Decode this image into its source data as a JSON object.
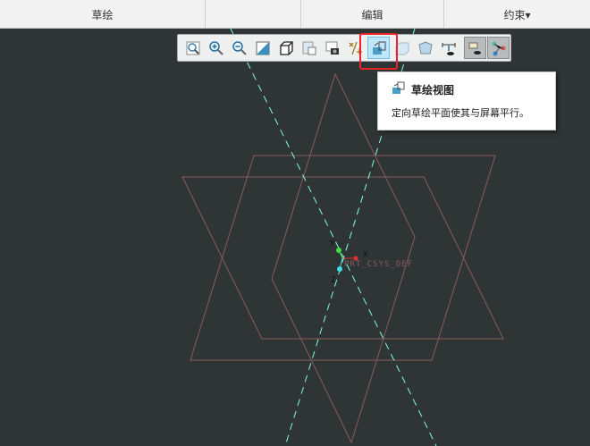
{
  "header": {
    "tabs": [
      {
        "label": "草绘"
      },
      {
        "label": "编辑"
      },
      {
        "label": "约束▾"
      }
    ]
  },
  "toolbar": {
    "buttons": [
      {
        "name": "refit-icon"
      },
      {
        "name": "zoom-in-icon"
      },
      {
        "name": "zoom-out-icon"
      },
      {
        "name": "repaint-icon"
      },
      {
        "name": "display-style-icon"
      },
      {
        "name": "saved-orientations-icon"
      },
      {
        "name": "view-manager-icon"
      },
      {
        "name": "datum-display-icon"
      },
      {
        "name": "sketch-view-icon",
        "active": true
      },
      {
        "name": "view-box-icon"
      },
      {
        "name": "perspective-icon"
      },
      {
        "name": "sketcher-display-icon"
      },
      {
        "name": "constraint-display-icon",
        "pressed": true
      },
      {
        "name": "dimension-display-icon",
        "pressed": true
      }
    ]
  },
  "tooltip": {
    "title": "草绘视图",
    "description": "定向草绘平面使其与屏幕平行。"
  },
  "csys": {
    "label": "PRT_CSYS_DEF",
    "x": "X",
    "y": "Y",
    "z": "Z"
  },
  "colors": {
    "background": "#2f3535",
    "sketch": "#8a5a5e",
    "centerline": "#7fffd4",
    "highlight": "#e8252a"
  }
}
